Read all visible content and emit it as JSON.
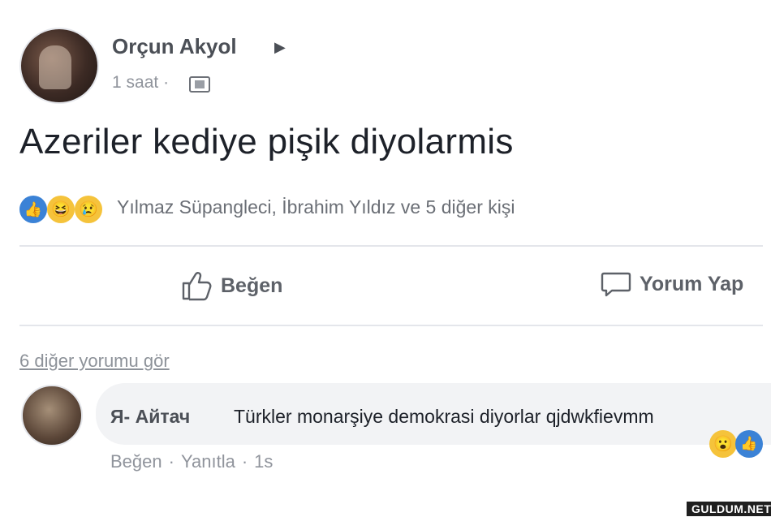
{
  "post": {
    "author": "Orçun Akyol",
    "time": "1 saat",
    "separator": "·",
    "text": "Azeriler kediye pişik diyolarmis",
    "reactions_summary": "Yılmaz Süpangleci, İbrahim Yıldız ve 5 diğer kişi"
  },
  "actions": {
    "like": "Beğen",
    "comment": "Yorum Yap"
  },
  "comments": {
    "see_more": "6 diğer yorumu gör",
    "items": [
      {
        "author": "Я- Айтач",
        "text": "Türkler monarşiye demokrasi diyorlar qjdwkfievmm",
        "like": "Beğen",
        "reply": "Yanıtla",
        "time": "1s",
        "separator": "·"
      }
    ]
  },
  "watermark": "GULDUM.NET",
  "icons": {
    "reaction_like": "like-reaction-icon",
    "reaction_haha": "haha-reaction-icon",
    "reaction_sad": "sad-reaction-icon",
    "reaction_wow": "wow-reaction-icon",
    "privacy": "public-privacy-icon",
    "thumb": "thumbs-up-icon",
    "comment": "speech-bubble-icon"
  },
  "colors": {
    "like_blue": "#3b82d6",
    "emoji_yellow": "#f5c33b",
    "secondary_text": "#90949c"
  }
}
